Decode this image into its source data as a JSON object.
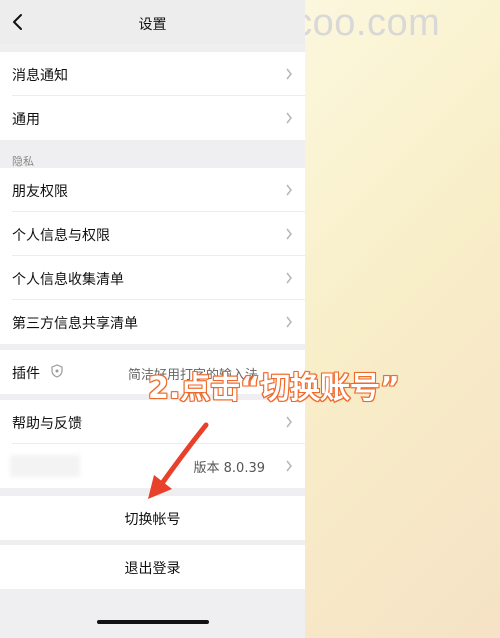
{
  "watermark": "khcoo.com",
  "nav": {
    "title": "设置"
  },
  "group1": [
    {
      "label": "消息通知"
    },
    {
      "label": "通用"
    }
  ],
  "section_privacy": "隐私",
  "group2": [
    {
      "label": "朋友权限"
    },
    {
      "label": "个人信息与权限"
    },
    {
      "label": "个人信息收集清单"
    },
    {
      "label": "第三方信息共享清单"
    }
  ],
  "plugin": {
    "label": "插件",
    "value": "简洁好用打字的输入法"
  },
  "help": {
    "label": "帮助与反馈"
  },
  "about": {
    "version": "版本 8.0.39"
  },
  "switch_account": "切换帐号",
  "logout": "退出登录",
  "annotation": "2.点击“切换账号”",
  "colors": {
    "annotation_stroke": "#ef6a2b",
    "arrow": "#e8402a"
  }
}
